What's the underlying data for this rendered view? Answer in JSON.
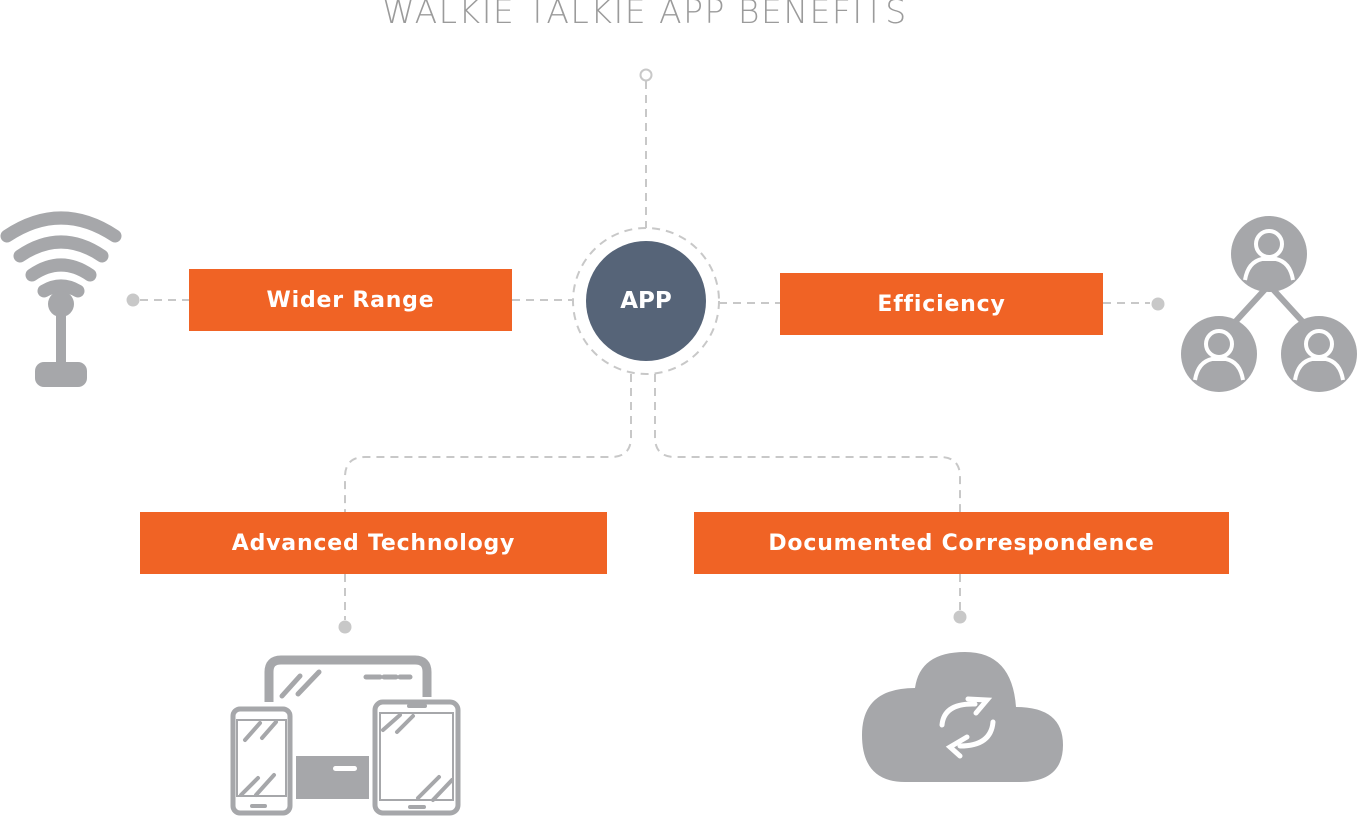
{
  "title": "WALKIE TALKIE APP BENEFITS",
  "hub": {
    "label": "APP",
    "color": "#566478"
  },
  "accent_color": "#f06325",
  "icon_color": "#a6a7aa",
  "connector_color": "#c8c8c8",
  "benefits": [
    {
      "label": "Wider Range",
      "icon": "wifi-antenna-icon"
    },
    {
      "label": "Efficiency",
      "icon": "team-hierarchy-icon"
    },
    {
      "label": "Advanced Technology",
      "icon": "multi-device-icon"
    },
    {
      "label": "Documented Correspondence",
      "icon": "cloud-sync-icon"
    }
  ]
}
